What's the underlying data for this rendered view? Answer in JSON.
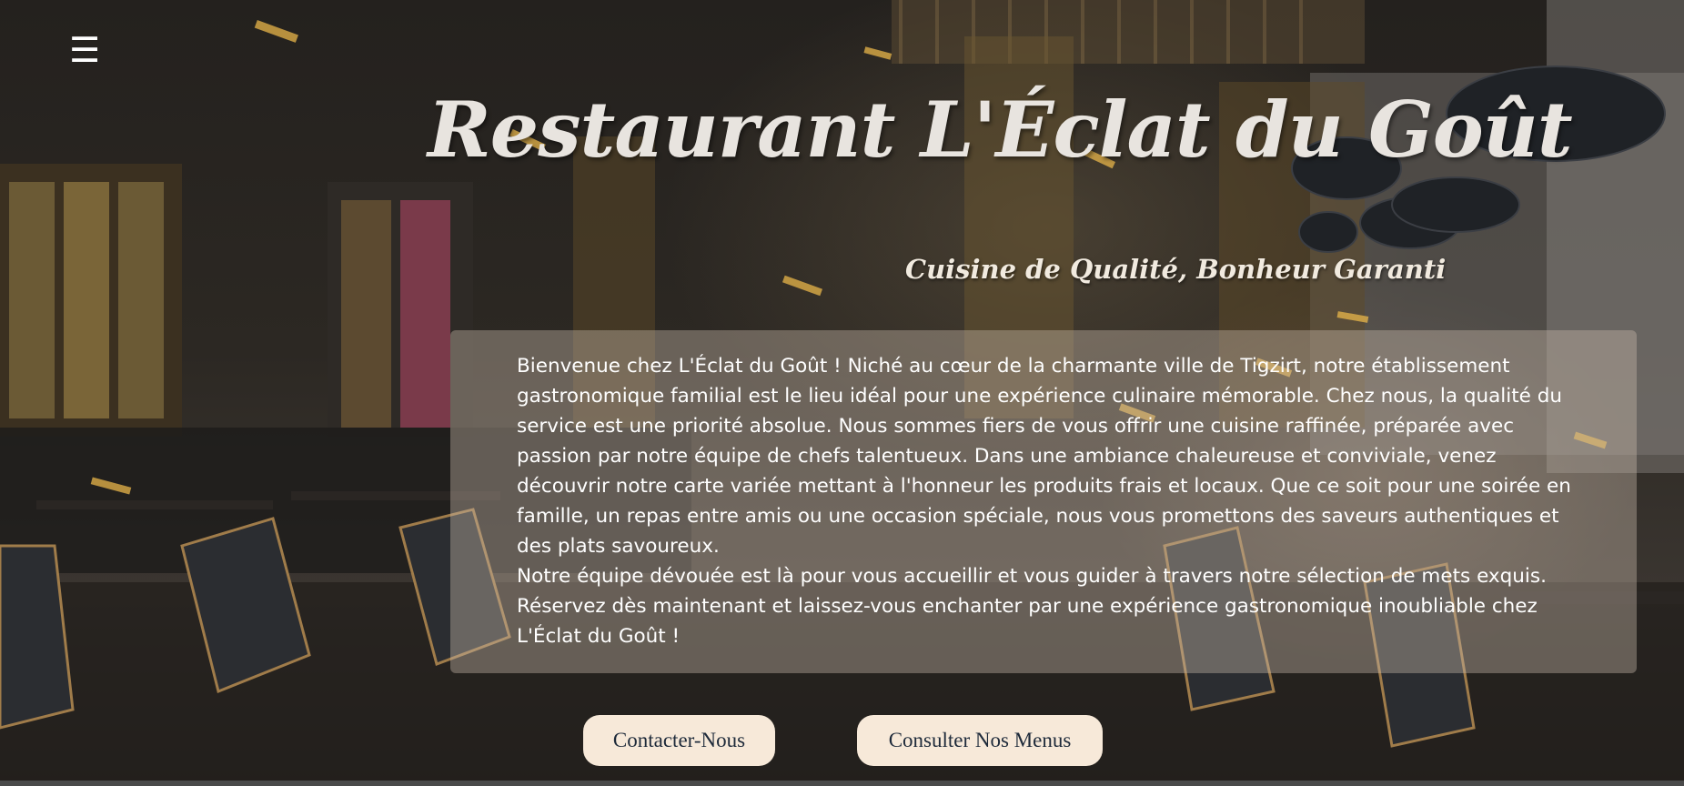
{
  "header": {
    "menu_icon": "hamburger-menu-icon",
    "menu_glyph": "☰",
    "title": "Restaurant L'Éclat du Goût",
    "tagline": "Cuisine de Qualité, Bonheur Garanti"
  },
  "intro": {
    "paragraph_1": "Bienvenue chez L'Éclat du Goût ! Niché au cœur de la charmante ville de Tigzirt, notre établissement gastronomique familial est le lieu idéal pour une expérience culinaire mémorable. Chez nous, la qualité du service est une priorité absolue. Nous sommes fiers de vous offrir une cuisine raffinée, préparée avec passion par notre équipe de chefs talentueux. Dans une ambiance chaleureuse et conviviale, venez découvrir notre carte variée mettant à l'honneur les produits frais et locaux. Que ce soit pour une soirée en famille, un repas entre amis ou une occasion spéciale, nous vous promettons des saveurs authentiques et des plats savoureux.",
    "paragraph_2": "Notre équipe dévouée est là pour vous accueillir et vous guider à travers notre sélection de mets exquis. Réservez dès maintenant et laissez-vous enchanter par une expérience gastronomique inoubliable chez L'Éclat du Goût !"
  },
  "actions": {
    "contact_label": "Contacter-Nous",
    "menus_label": "Consulter Nos Menus"
  },
  "colors": {
    "button_background": "#f7e9d9",
    "button_text": "#1e2a3a",
    "title_text": "#e8e4df",
    "overlay": "rgba(200,185,170,0.40)"
  }
}
